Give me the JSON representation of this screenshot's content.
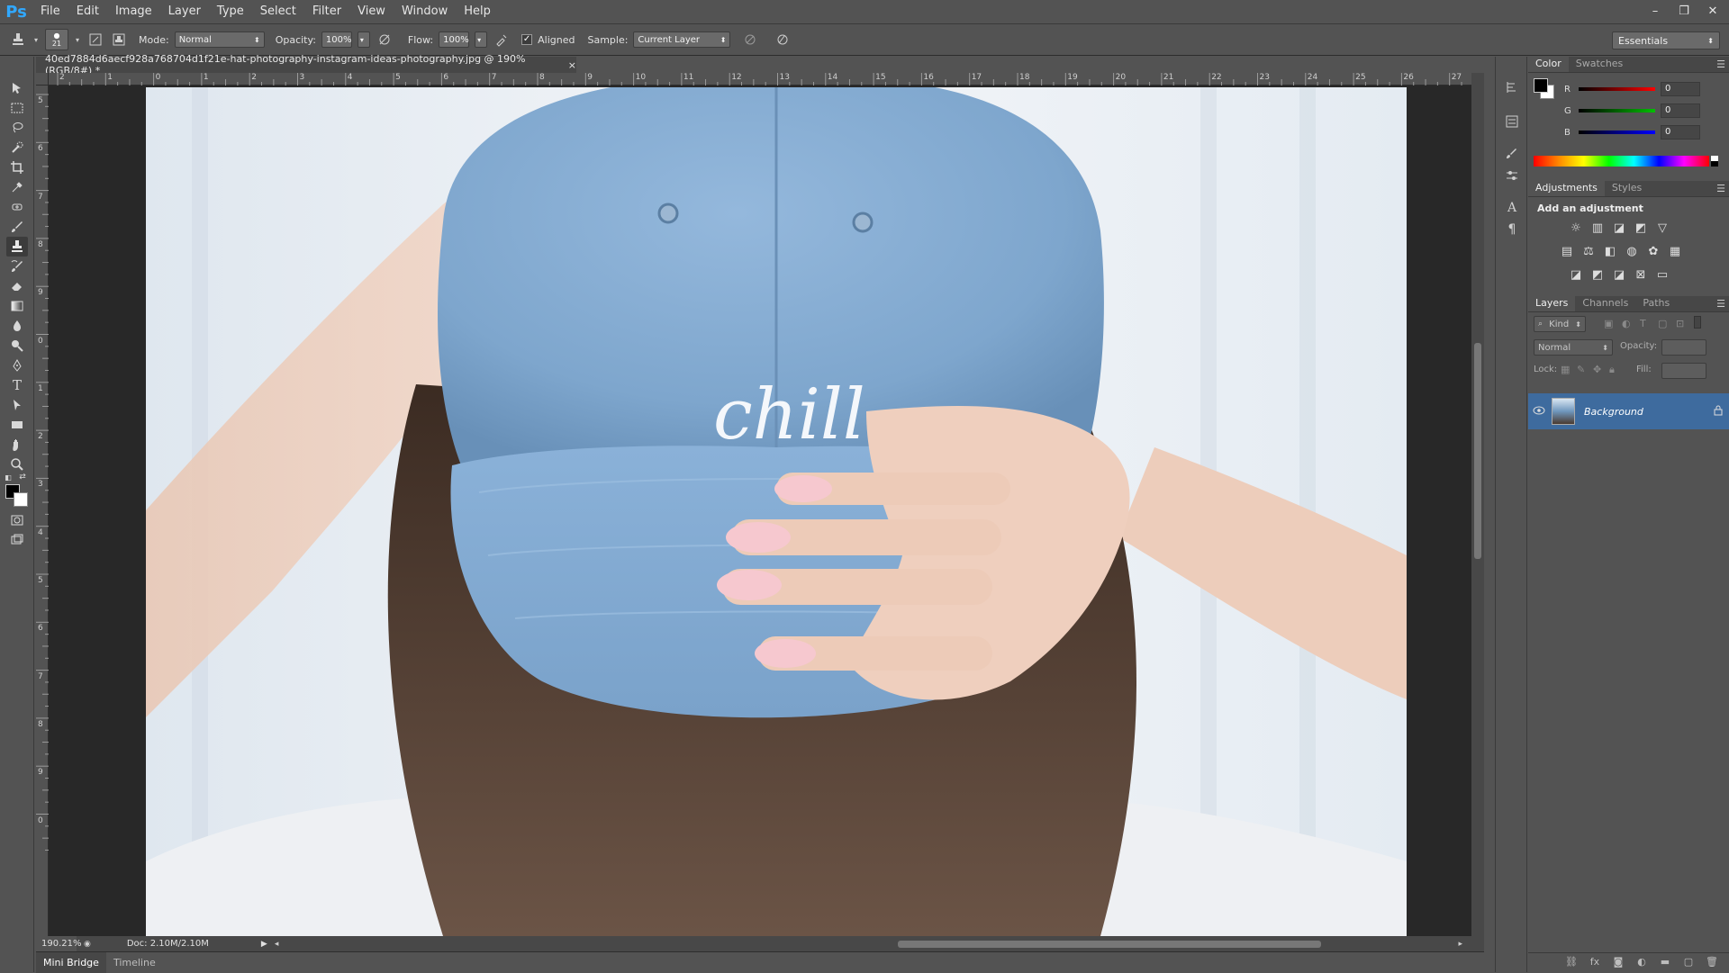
{
  "app": {
    "logo": "Ps",
    "menu": [
      "File",
      "Edit",
      "Image",
      "Layer",
      "Type",
      "Select",
      "Filter",
      "View",
      "Window",
      "Help"
    ],
    "window_controls": {
      "minimize": "–",
      "restore": "❐",
      "close": "✕"
    }
  },
  "options": {
    "brush_size": "21",
    "mode_label": "Mode:",
    "mode_value": "Normal",
    "opacity_label": "Opacity:",
    "opacity_value": "100%",
    "flow_label": "Flow:",
    "flow_value": "100%",
    "aligned_label": "Aligned",
    "aligned_checked": true,
    "sample_label": "Sample:",
    "sample_value": "Current Layer",
    "workspace": "Essentials"
  },
  "document": {
    "tab_title": "40ed7884d6aecf928a768704d1f21e-hat-photography-instagram-ideas-photography.jpg @ 190% (RGB/8#) *",
    "close": "×",
    "ruler_h": [
      "2",
      "1",
      "0",
      "1",
      "2",
      "3",
      "4",
      "5",
      "6",
      "7",
      "8",
      "9",
      "10",
      "11",
      "12",
      "13",
      "14",
      "15",
      "16",
      "17",
      "18",
      "19",
      "20",
      "21",
      "22",
      "23",
      "24",
      "25",
      "26",
      "27"
    ],
    "ruler_v": [
      "5",
      "6",
      "7",
      "8",
      "9",
      "0",
      "1",
      "2",
      "3",
      "4",
      "5",
      "6",
      "7",
      "8",
      "9",
      "0"
    ],
    "hat_text": "chill",
    "zoom": "190.21%",
    "doc_info": "Doc: 2.10M/2.10M"
  },
  "bottom_tabs": [
    "Mini Bridge",
    "Timeline"
  ],
  "panels": {
    "color_tabs": [
      "Color",
      "Swatches"
    ],
    "rgb": [
      {
        "label": "R",
        "value": "0",
        "color": "#ff0000"
      },
      {
        "label": "G",
        "value": "0",
        "color": "#00c000"
      },
      {
        "label": "B",
        "value": "0",
        "color": "#0000ff"
      }
    ],
    "adjust_tabs": [
      "Adjustments",
      "Styles"
    ],
    "adjust_title": "Add an adjustment",
    "layers_tabs": [
      "Layers",
      "Channels",
      "Paths"
    ],
    "kind_label": "Kind",
    "blend_mode": "Normal",
    "opacity_label": "Opacity:",
    "lock_label": "Lock:",
    "fill_label": "Fill:",
    "layer_name": "Background"
  },
  "colors": {
    "accent": "#31a8ff",
    "layer_selected": "#3e6b9e",
    "background": "#535353",
    "hat": "#7ea6cd"
  }
}
